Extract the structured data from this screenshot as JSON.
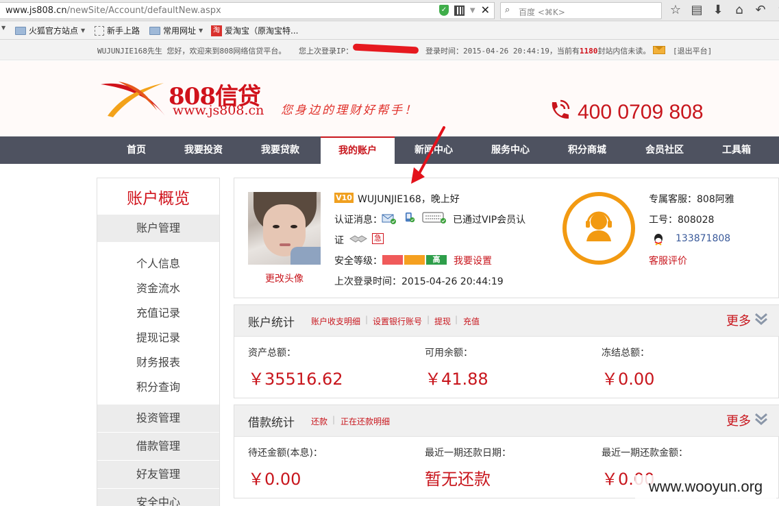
{
  "browser": {
    "url_host": "www.js808.cn",
    "url_path": "/newSite/Account/defaultNew.aspx",
    "search_placeholder": "百度 <⌘K>",
    "bookmarks": [
      {
        "label": "火狐官方站点",
        "icon": "folder-icon",
        "has_dropdown": true
      },
      {
        "label": "新手上路",
        "icon": "page-icon",
        "has_dropdown": false
      },
      {
        "label": "常用网址",
        "icon": "folder-icon",
        "has_dropdown": true
      },
      {
        "label": "爱淘宝（原淘宝特...",
        "icon": "taobao-icon",
        "has_dropdown": false
      }
    ]
  },
  "infobar": {
    "greeting": "WUJUNJIE168先生 您好，欢迎来到808网络信贷平台。",
    "last_ip_label": "您上次登录IP：",
    "last_ip_value": "",
    "login_time": "登录时间：2015-04-26 20:44:19，当前有",
    "unread_count": "1180",
    "unread_suffix": "封站内信未读。",
    "logout": "[退出平台]"
  },
  "header": {
    "logo_title": "808信贷",
    "logo_url": "www.js808.cn",
    "slogan": "您身边的理财好帮手！",
    "phone": "400 0709 808",
    "brand_color": "#d0121b"
  },
  "nav": {
    "items": [
      "首页",
      "我要投资",
      "我要贷款",
      "我的账户",
      "新闻中心",
      "服务中心",
      "积分商城",
      "会员社区",
      "工具箱"
    ],
    "active_index": 3
  },
  "sidebar": {
    "title": "账户概览",
    "groups": [
      {
        "label": "账户管理",
        "items": [
          "个人信息",
          "资金流水",
          "充值记录",
          "提现记录",
          "财务报表",
          "积分查询"
        ]
      },
      {
        "label": "投资管理",
        "items": []
      },
      {
        "label": "借款管理",
        "items": []
      },
      {
        "label": "好友管理",
        "items": []
      },
      {
        "label": "安全中心",
        "items": []
      }
    ]
  },
  "profile": {
    "vip_badge": "V10",
    "greeting": "WUJUNJIE168，晚上好",
    "auth_label": "认证消息：",
    "auth_text_1": "已通过VIP会员认",
    "auth_text_2": "证",
    "urgent_icon_text": "急",
    "security_label": "安全等级：",
    "security_high": "高",
    "security_settings": "我要设置",
    "last_login": "上次登录时间：2015-04-26 20:44:19",
    "change_avatar": "更改头像"
  },
  "service": {
    "agent": "专属客服：808阿雅",
    "employee_id": "工号：808028",
    "qq": "133871808",
    "rate_link": "客服评价"
  },
  "account_stats": {
    "title": "账户统计",
    "links": [
      "账户收支明细",
      "设置银行账号",
      "提现",
      "充值"
    ],
    "more": "更多",
    "items": [
      {
        "label": "资产总额：",
        "value": "￥35516.62"
      },
      {
        "label": "可用余额：",
        "value": "￥41.88"
      },
      {
        "label": "冻结总额：",
        "value": "￥0.00"
      }
    ]
  },
  "loan_stats": {
    "title": "借款统计",
    "links": [
      "还款",
      "正在还款明细"
    ],
    "more": "更多",
    "items": [
      {
        "label": "待还金额(本息)：",
        "value": "￥0.00"
      },
      {
        "label": "最近一期还款日期：",
        "value": "暂无还款"
      },
      {
        "label": "最近一期还款金额：",
        "value": "￥0.00"
      }
    ]
  },
  "watermark": "www.wooyun.org"
}
